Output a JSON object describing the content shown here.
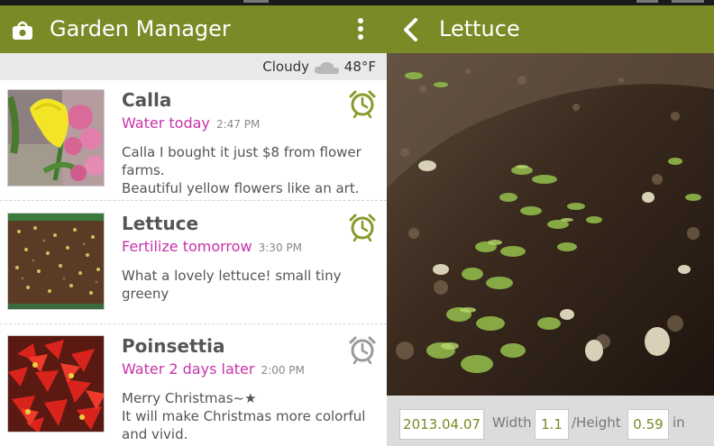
{
  "app": {
    "title": "Garden Manager"
  },
  "weather": {
    "condition": "Cloudy",
    "temperature": "48°F"
  },
  "plants": [
    {
      "name": "Calla",
      "task": "Water today",
      "time": "2:47 PM",
      "note": "Calla I bought it just $8 from flower farms.\nBeautiful yellow flowers like an art.",
      "alarm_active": true
    },
    {
      "name": "Lettuce",
      "task": "Fertilize tomorrow",
      "time": "3:30 PM",
      "note": "What a lovely lettuce! small tiny greeny",
      "alarm_active": true
    },
    {
      "name": "Poinsettia",
      "task": "Water 2 days later",
      "time": "2:00 PM",
      "note": "Merry Christmas~★\nIt will make Christmas more colorful and vivid.",
      "alarm_active": false
    }
  ],
  "detail": {
    "title": "Lettuce",
    "date": "2013.04.07",
    "width_label": "Width",
    "width_value": "1.1",
    "height_label": "/Height",
    "height_value": "0.59",
    "unit": "in"
  },
  "colors": {
    "accent": "#7a8a26",
    "task": "#c832a8",
    "alarm_active": "#8a9a2a",
    "alarm_inactive": "#9a9a9a"
  },
  "icons": {
    "app": "basket-icon",
    "menu": "more-vert-icon",
    "weather": "cloud-icon",
    "alarm": "alarm-clock-icon",
    "back": "chevron-left-icon"
  }
}
